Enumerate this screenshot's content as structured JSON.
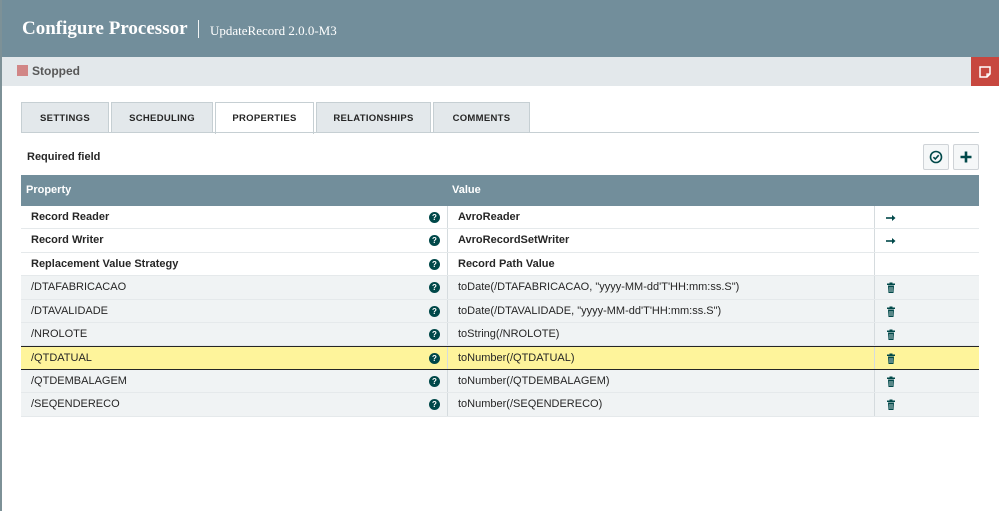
{
  "header": {
    "title": "Configure Processor",
    "subtitle": "UpdateRecord 2.0.0-M3"
  },
  "status": {
    "label": "Stopped",
    "color": "#d18686"
  },
  "tabs": [
    {
      "label": "SETTINGS",
      "active": false
    },
    {
      "label": "SCHEDULING",
      "active": false
    },
    {
      "label": "PROPERTIES",
      "active": true
    },
    {
      "label": "RELATIONSHIPS",
      "active": false
    },
    {
      "label": "COMMENTS",
      "active": false
    }
  ],
  "properties": {
    "required_label": "Required field",
    "columns": {
      "property": "Property",
      "value": "Value"
    },
    "rows": [
      {
        "name": "Record Reader",
        "value": "AvroReader",
        "required": true,
        "action": "arrow-right-icon"
      },
      {
        "name": "Record Writer",
        "value": "AvroRecordSetWriter",
        "required": true,
        "action": "arrow-right-icon"
      },
      {
        "name": "Replacement Value Strategy",
        "value": "Record Path Value",
        "required": true,
        "action": ""
      },
      {
        "name": "/DTAFABRICACAO",
        "value": "toDate(/DTAFABRICACAO, \"yyyy-MM-dd'T'HH:mm:ss.S\")",
        "required": false,
        "action": "trash-icon"
      },
      {
        "name": "/DTAVALIDADE",
        "value": "toDate(/DTAVALIDADE, \"yyyy-MM-dd'T'HH:mm:ss.S\")",
        "required": false,
        "action": "trash-icon"
      },
      {
        "name": "/NROLOTE",
        "value": "toString(/NROLOTE)",
        "required": false,
        "action": "trash-icon"
      },
      {
        "name": "/QTDATUAL",
        "value": "toNumber(/QTDATUAL)",
        "required": false,
        "action": "trash-icon",
        "selected": true
      },
      {
        "name": "/QTDEMBALAGEM",
        "value": "toNumber(/QTDEMBALAGEM)",
        "required": false,
        "action": "trash-icon"
      },
      {
        "name": "/SEQENDERECO",
        "value": "toNumber(/SEQENDERECO)",
        "required": false,
        "action": "trash-icon"
      }
    ]
  },
  "colors": {
    "header": "#728e9b",
    "selected_row": "#fef49b",
    "accent": "#004849",
    "note_button": "#c7473f"
  }
}
